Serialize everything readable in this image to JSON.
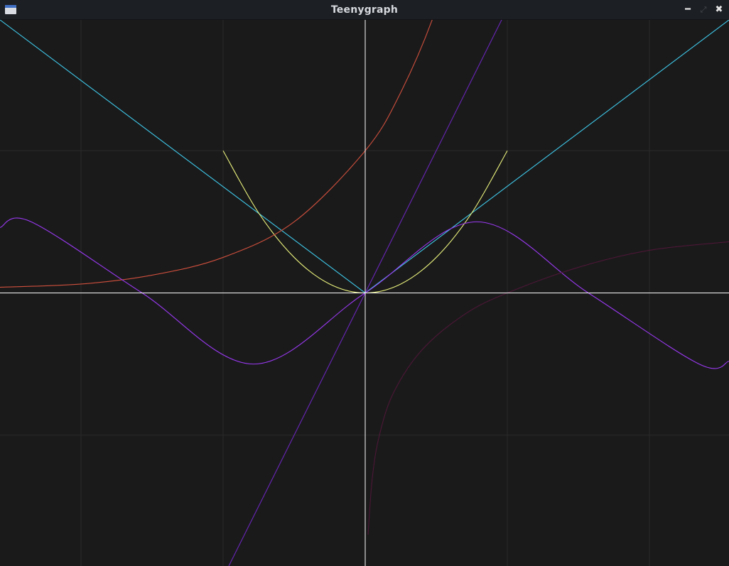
{
  "window": {
    "title": "Teenygraph"
  },
  "icons": {
    "app": "app-window-icon",
    "minimize": "minimize-icon",
    "restore": "restore-icon",
    "close": "close-icon"
  },
  "colors": {
    "background": "#1a1a1b",
    "grid": "#2b2b2b",
    "axes": "#ffffff",
    "abs": "#3fc9e8",
    "square": "#e8f07a",
    "exp": "#d0503c",
    "sin": "#9a39f0",
    "linear": "#6a26b8",
    "log": "#4d1736"
  },
  "chart_data": {
    "type": "line",
    "xlim": [
      -2.57,
      2.56
    ],
    "ylim": [
      -1.92,
      1.92
    ],
    "grid": true,
    "grid_step": 1,
    "series": [
      {
        "color_key": "abs",
        "x": [
          -2.57,
          0,
          2.56
        ],
        "y": [
          1.92,
          0,
          1.92
        ]
      },
      {
        "color_key": "square",
        "x": [
          -1.0,
          -0.75,
          -0.5,
          -0.25,
          0,
          0.25,
          0.5,
          0.75,
          1.0
        ],
        "y": [
          1.0,
          0.5625,
          0.25,
          0.0625,
          0,
          0.0625,
          0.25,
          0.5625,
          1.0
        ]
      },
      {
        "color_key": "exp",
        "x": [
          -2.57,
          -2.0,
          -1.5,
          -1.0,
          -0.5,
          0,
          0.25,
          0.5,
          0.75,
          1.0
        ],
        "y": [
          0.04,
          0.0625,
          0.125,
          0.25,
          0.5,
          1.0,
          1.41,
          2.0,
          2.83,
          4.0
        ]
      },
      {
        "color_key": "sin",
        "x": [
          -2.57,
          -2.35,
          -1.57,
          -0.785,
          0,
          0.785,
          1.57,
          2.35,
          2.56
        ],
        "y": [
          0.46,
          0.5,
          0,
          -0.5,
          0,
          0.5,
          0,
          -0.5,
          -0.48
        ]
      },
      {
        "color_key": "linear",
        "x": [
          -0.96,
          0,
          0.98
        ],
        "y": [
          -1.92,
          0,
          1.96
        ]
      },
      {
        "color_key": "log",
        "x": [
          0.02,
          0.05,
          0.1,
          0.2,
          0.4,
          0.7,
          1.0,
          1.5,
          2.0,
          2.56
        ],
        "y": [
          -1.7,
          -1.3,
          -1.0,
          -0.7,
          -0.4,
          -0.15,
          0.0,
          0.18,
          0.3,
          0.36
        ]
      }
    ]
  }
}
